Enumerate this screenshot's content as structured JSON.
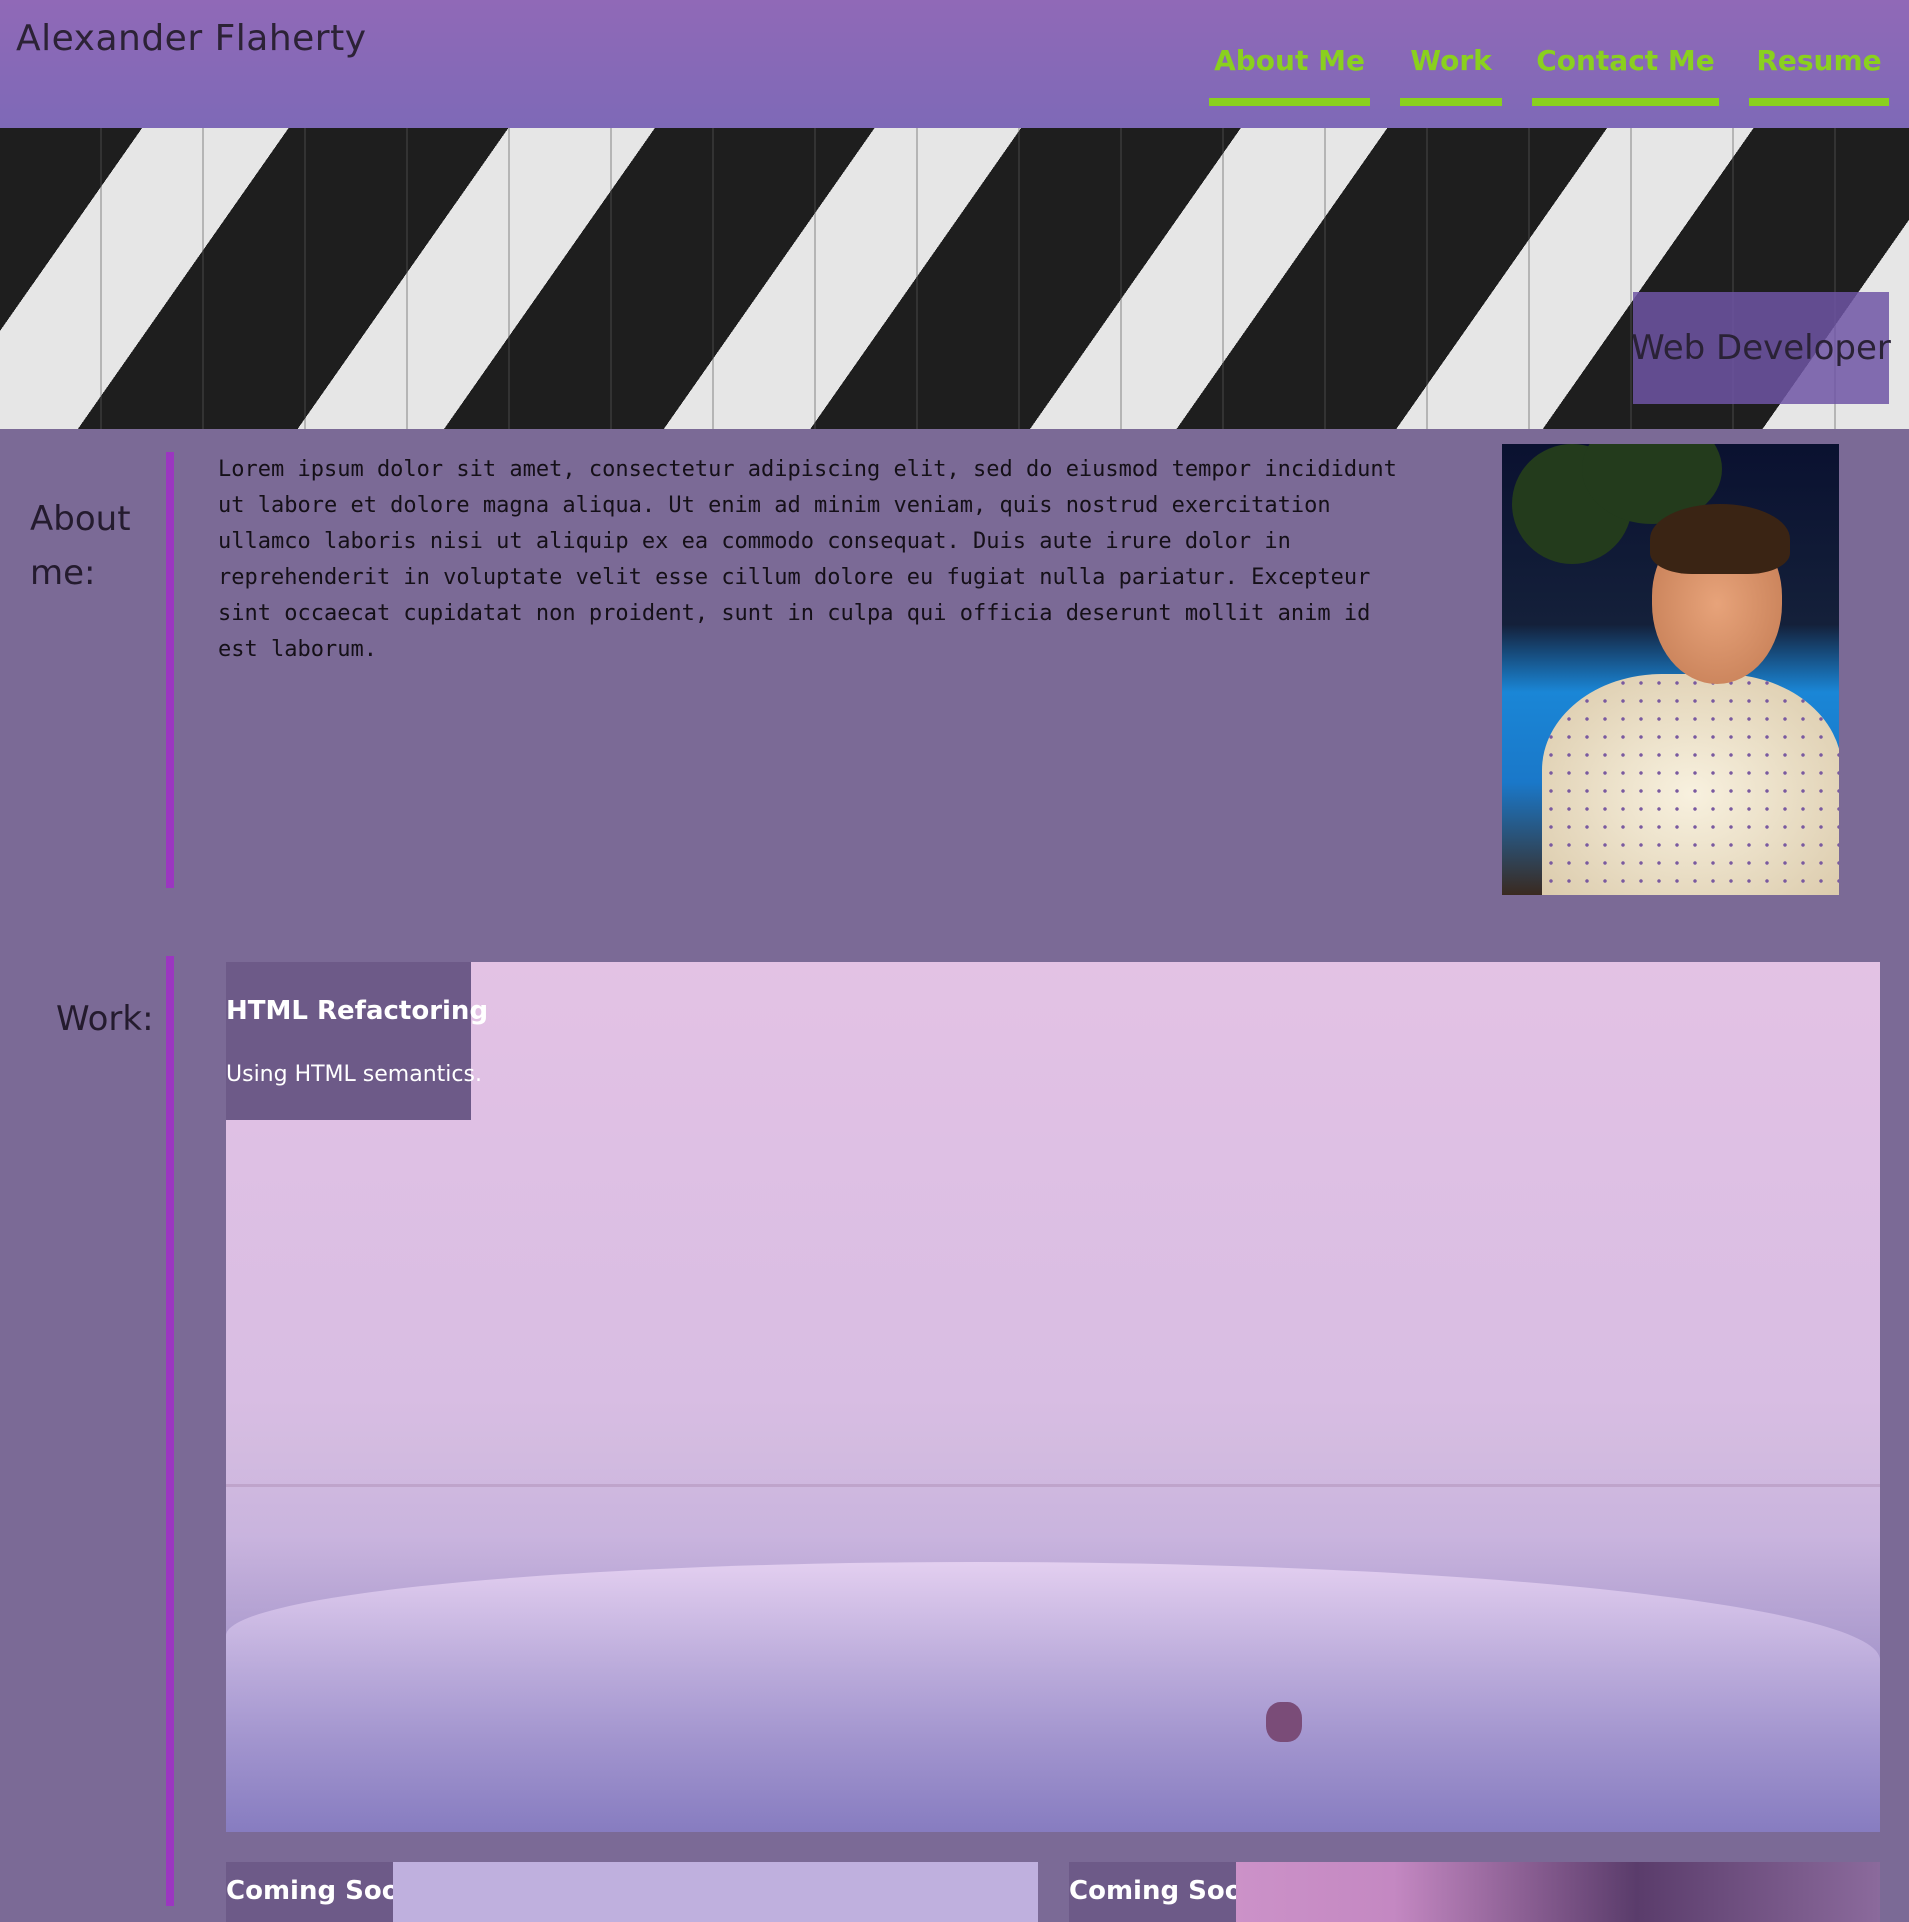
{
  "header": {
    "site_name": "Alexander Flaherty",
    "nav": [
      {
        "label": "About Me"
      },
      {
        "label": "Work"
      },
      {
        "label": "Contact Me"
      },
      {
        "label": "Resume"
      }
    ],
    "accent_color": "#8ad01e"
  },
  "hero": {
    "tagline": "Web Developer"
  },
  "about": {
    "heading_line1": "About",
    "heading_line2": "me:",
    "body": "Lorem ipsum dolor sit amet, consectetur adipiscing elit, sed do eiusmod tempor incididunt ut labore et dolore magna aliqua. Ut enim ad minim veniam, quis nostrud exercitation ullamco laboris nisi ut aliquip ex ea commodo consequat. Duis aute irure dolor in reprehenderit in voluptate velit esse cillum dolore eu fugiat nulla pariatur. Excepteur sint occaecat cupidatat non proident, sunt in culpa qui officia deserunt mollit anim id est laborum."
  },
  "work": {
    "heading": "Work:",
    "featured": {
      "title": "HTML Refactoring",
      "description": "Using HTML semantics."
    },
    "secondary": [
      {
        "title": "Coming Soon"
      },
      {
        "title": "Coming Soon"
      }
    ]
  },
  "colors": {
    "header_top": "#9069b7",
    "page_bg": "#7b6a96",
    "divider": "#9b36c0",
    "card_label_bg": "#6d5a88"
  }
}
